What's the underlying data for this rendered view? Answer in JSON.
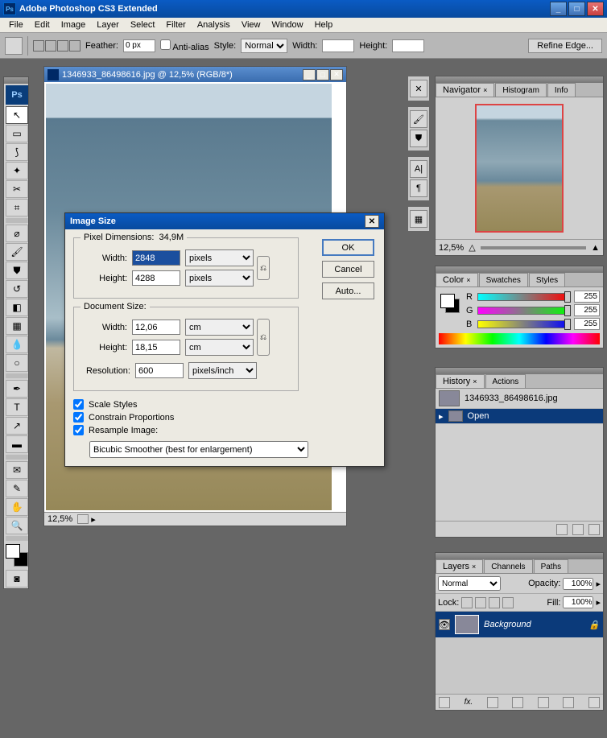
{
  "app": {
    "title": "Adobe Photoshop CS3 Extended"
  },
  "menu": [
    "File",
    "Edit",
    "Image",
    "Layer",
    "Select",
    "Filter",
    "Analysis",
    "View",
    "Window",
    "Help"
  ],
  "options": {
    "feather_label": "Feather:",
    "feather": "0 px",
    "antialias": "Anti-alias",
    "style_label": "Style:",
    "style": "Normal",
    "width_label": "Width:",
    "width": "",
    "height_label": "Height:",
    "height": "",
    "refine": "Refine Edge..."
  },
  "doc": {
    "title": "1346933_86498616.jpg @ 12,5% (RGB/8*)",
    "zoom": "12,5%"
  },
  "dialog": {
    "title": "Image Size",
    "pixdim_label": "Pixel Dimensions:",
    "pixdim_size": "34,9M",
    "width_label": "Width:",
    "pwidth": "2848",
    "pwidth_unit": "pixels",
    "height_label": "Height:",
    "pheight": "4288",
    "pheight_unit": "pixels",
    "docsize_label": "Document Size:",
    "dwidth": "12,06",
    "dwidth_unit": "cm",
    "dheight": "18,15",
    "dheight_unit": "cm",
    "res_label": "Resolution:",
    "res": "600",
    "res_unit": "pixels/inch",
    "scale": "Scale Styles",
    "constrain": "Constrain Proportions",
    "resample": "Resample Image:",
    "method": "Bicubic Smoother (best for enlargement)",
    "ok": "OK",
    "cancel": "Cancel",
    "auto": "Auto..."
  },
  "nav": {
    "tabs": [
      "Navigator",
      "Histogram",
      "Info"
    ],
    "zoom": "12,5%"
  },
  "color": {
    "tabs": [
      "Color",
      "Swatches",
      "Styles"
    ],
    "r": "255",
    "g": "255",
    "b": "255"
  },
  "history": {
    "tabs": [
      "History",
      "Actions"
    ],
    "doc": "1346933_86498616.jpg",
    "open": "Open"
  },
  "layers": {
    "tabs": [
      "Layers",
      "Channels",
      "Paths"
    ],
    "mode": "Normal",
    "opacity_label": "Opacity:",
    "opacity": "100%",
    "lock_label": "Lock:",
    "fill_label": "Fill:",
    "fill": "100%",
    "bg": "Background"
  }
}
